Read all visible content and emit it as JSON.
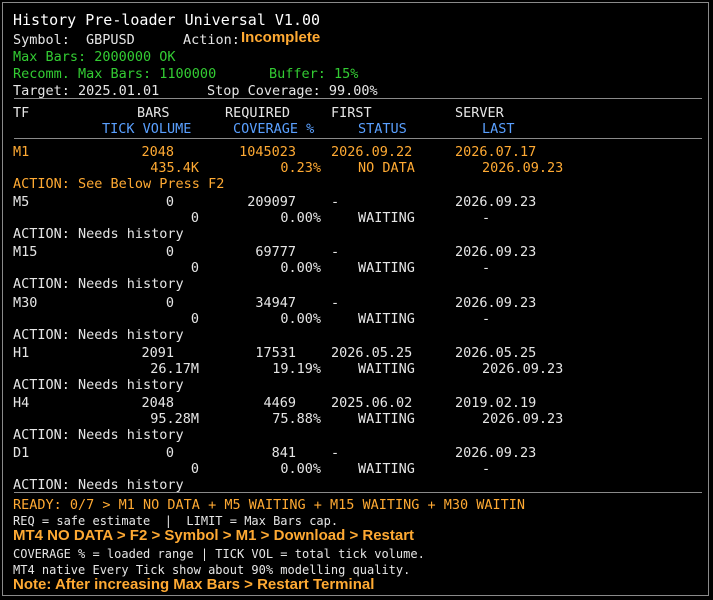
{
  "title": "History Pre-loader Universal V1.00",
  "symbol_label": "Symbol:",
  "symbol": "GBPUSD",
  "action_label": "Action:",
  "action": "Incomplete",
  "max_bars": "Max Bars: 2000000 OK",
  "recomm": "Recomm. Max Bars: 1100000",
  "buffer": "Buffer: 15%",
  "target": "Target: 2025.01.01",
  "stop_coverage": "Stop Coverage: 99.00%",
  "headers": {
    "tf": "TF",
    "bars": "BARS",
    "required": "REQUIRED",
    "first": "FIRST",
    "server": "SERVER",
    "tick_volume": "TICK VOLUME",
    "coverage": "COVERAGE %",
    "status": "STATUS",
    "last": "LAST"
  },
  "rows": [
    {
      "tf": "M1",
      "bars": "2048",
      "required": "1045023",
      "first": "2026.09.22",
      "server": "2026.07.17",
      "tick": "435.4K",
      "coverage": "0.23%",
      "status": "NO DATA",
      "last": "2026.09.23",
      "action": "ACTION: See Below Press F2",
      "highlight": true
    },
    {
      "tf": "M5",
      "bars": "0",
      "required": "209097",
      "first": "-",
      "server": "2026.09.23",
      "tick": "0",
      "coverage": "0.00%",
      "status": "WAITING",
      "last": "-",
      "action": "ACTION: Needs history",
      "highlight": false
    },
    {
      "tf": "M15",
      "bars": "0",
      "required": "69777",
      "first": "-",
      "server": "2026.09.23",
      "tick": "0",
      "coverage": "0.00%",
      "status": "WAITING",
      "last": "-",
      "action": "ACTION: Needs history",
      "highlight": false
    },
    {
      "tf": "M30",
      "bars": "0",
      "required": "34947",
      "first": "-",
      "server": "2026.09.23",
      "tick": "0",
      "coverage": "0.00%",
      "status": "WAITING",
      "last": "-",
      "action": "ACTION: Needs history",
      "highlight": false
    },
    {
      "tf": "H1",
      "bars": "2091",
      "required": "17531",
      "first": "2026.05.25",
      "server": "2026.05.25",
      "tick": "26.17M",
      "coverage": "19.19%",
      "status": "WAITING",
      "last": "2026.09.23",
      "action": "ACTION: Needs history",
      "highlight": false
    },
    {
      "tf": "H4",
      "bars": "2048",
      "required": "4469",
      "first": "2025.06.02",
      "server": "2019.02.19",
      "tick": "95.28M",
      "coverage": "75.88%",
      "status": "WAITING",
      "last": "2026.09.23",
      "action": "ACTION: Needs history",
      "highlight": false
    },
    {
      "tf": "D1",
      "bars": "0",
      "required": "841",
      "first": "-",
      "server": "2026.09.23",
      "tick": "0",
      "coverage": "0.00%",
      "status": "WAITING",
      "last": "-",
      "action": "ACTION: Needs history",
      "highlight": false
    }
  ],
  "footer": {
    "ready": "READY: 0/7 > M1 NO DATA + M5 WAITING + M15 WAITING + M30 WAITIN",
    "req": "REQ = safe estimate  |  LIMIT = Max Bars cap.",
    "mt4": "MT4 NO DATA > F2 > Symbol > M1 > Download > Restart",
    "coverage_note": "COVERAGE % = loaded range | TICK VOL = total tick volume.",
    "native": "MT4 native Every Tick show about 90% modelling quality.",
    "note": "Note: After increasing Max Bars > Restart Terminal"
  },
  "colors": {
    "ok": "#33cc33",
    "warn": "#ffaa33",
    "header": "#5aa0ff",
    "text": "#e6e6e6"
  }
}
